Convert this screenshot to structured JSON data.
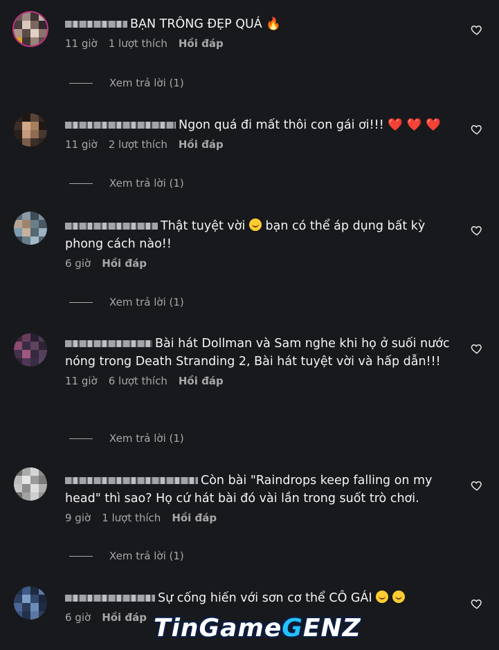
{
  "comments": [
    {
      "text": "BẠN TRÔNG ĐẸP QUÁ",
      "emoji": "🔥",
      "time": "11 giờ",
      "likes": "1 lượt thích",
      "reply": "Hồi đáp",
      "view_replies": "Xem trả lời (1)"
    },
    {
      "text": "Ngon quá đi mất thôi con gái ơi!!!",
      "emoji": "❤️ ❤️ ❤️",
      "time": "11 giờ",
      "likes": "2 lượt thích",
      "reply": "Hồi đáp",
      "view_replies": "Xem trả lời (1)"
    },
    {
      "text": "Thật tuyệt vời",
      "text_after": "bạn có thể áp dụng bất kỳ phong cách nào!!",
      "time": "6 giờ",
      "reply": "Hồi đáp",
      "view_replies": "Xem trả lời (1)"
    },
    {
      "text": "Bài hát Dollman và Sam nghe khi họ ở suối nước nóng trong Death Stranding 2, Bài hát tuyệt vời và hấp dẫn!!!",
      "time": "11 giờ",
      "likes": "6 lượt thích",
      "reply": "Hồi đáp",
      "view_replies": "Xem trả lời (1)"
    },
    {
      "text": "Còn bài \"Raindrops keep falling on my head\" thì sao? Họ cứ hát bài đó vài lần trong suốt trò chơi.",
      "time": "9 giờ",
      "likes": "1 lượt thích",
      "reply": "Hồi đáp",
      "view_replies": "Xem trả lời (1)"
    },
    {
      "text": "Sự cống hiến với sơn cơ thể CÔ GÁI",
      "time": "6 giờ",
      "reply": "Hồi đáp"
    }
  ],
  "icons": {
    "like": "heart-outline-icon"
  },
  "watermark": {
    "part1": "TinGame",
    "part2": "G",
    "part3": "ENZ"
  }
}
